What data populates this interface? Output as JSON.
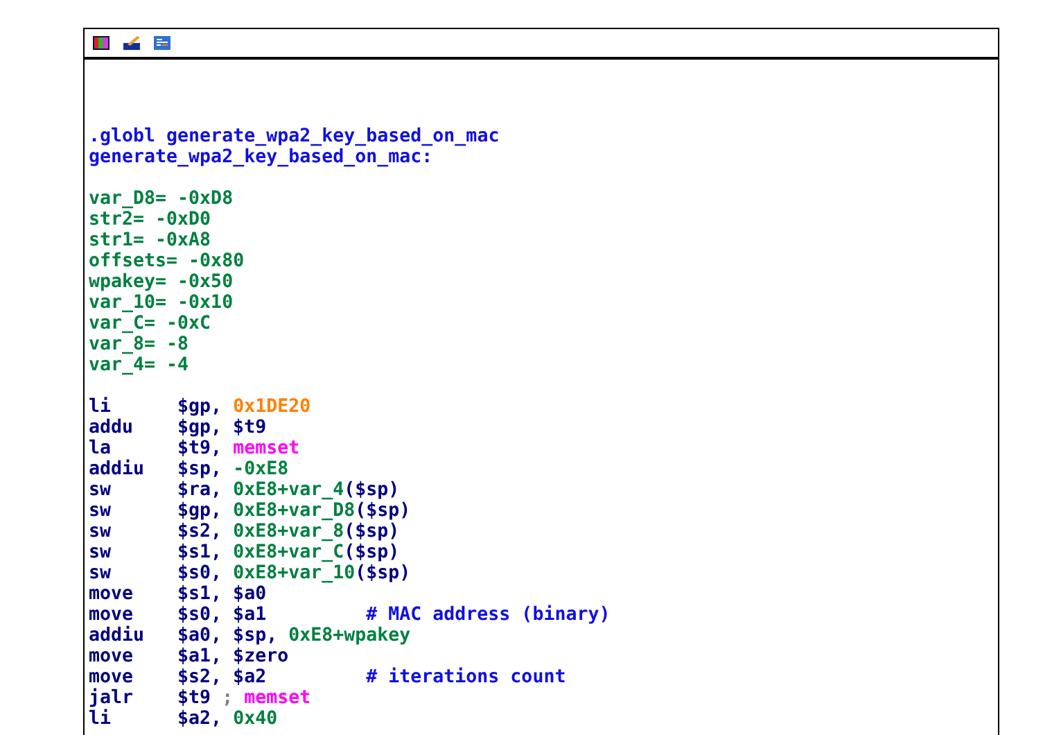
{
  "toolbar": {
    "buttons": [
      {
        "kind": "graph"
      },
      {
        "kind": "pencil"
      },
      {
        "kind": "text"
      }
    ]
  },
  "listing": [
    {
      "kind": "blank"
    },
    {
      "kind": "directive",
      "text": ".globl generate_wpa2_key_based_on_mac"
    },
    {
      "kind": "label",
      "text": "generate_wpa2_key_based_on_mac:"
    },
    {
      "kind": "blank"
    },
    {
      "kind": "var",
      "text": "var_D8= -0xD8"
    },
    {
      "kind": "var",
      "text": "str2= -0xD0"
    },
    {
      "kind": "var",
      "text": "str1= -0xA8"
    },
    {
      "kind": "var",
      "text": "offsets= -0x80"
    },
    {
      "kind": "var",
      "text": "wpakey= -0x50"
    },
    {
      "kind": "var",
      "text": "var_10= -0x10"
    },
    {
      "kind": "var",
      "text": "var_C= -0xC"
    },
    {
      "kind": "var",
      "text": "var_8= -8"
    },
    {
      "kind": "var",
      "text": "var_4= -4"
    },
    {
      "kind": "blank"
    },
    {
      "kind": "instr",
      "mnemonic": "li",
      "operands": [
        {
          "text": "$gp, ",
          "kind": "register"
        },
        {
          "text": "0x1DE20",
          "kind": "constant"
        }
      ]
    },
    {
      "kind": "instr",
      "mnemonic": "addu",
      "operands": [
        {
          "text": "$gp, $t9",
          "kind": "register"
        }
      ]
    },
    {
      "kind": "instr",
      "mnemonic": "la",
      "operands": [
        {
          "text": "$t9, ",
          "kind": "register"
        },
        {
          "text": "memset",
          "kind": "function"
        }
      ]
    },
    {
      "kind": "instr",
      "mnemonic": "addiu",
      "operands": [
        {
          "text": "$sp, ",
          "kind": "register"
        },
        {
          "text": "-0xE8",
          "kind": "number"
        }
      ]
    },
    {
      "kind": "instr",
      "mnemonic": "sw",
      "operands": [
        {
          "text": "$ra, ",
          "kind": "register"
        },
        {
          "text": "0xE8+var_4",
          "kind": "number"
        },
        {
          "text": "($sp)",
          "kind": "register"
        }
      ]
    },
    {
      "kind": "instr",
      "mnemonic": "sw",
      "operands": [
        {
          "text": "$gp, ",
          "kind": "register"
        },
        {
          "text": "0xE8+var_D8",
          "kind": "number"
        },
        {
          "text": "($sp)",
          "kind": "register"
        }
      ]
    },
    {
      "kind": "instr",
      "mnemonic": "sw",
      "operands": [
        {
          "text": "$s2, ",
          "kind": "register"
        },
        {
          "text": "0xE8+var_8",
          "kind": "number"
        },
        {
          "text": "($sp)",
          "kind": "register"
        }
      ]
    },
    {
      "kind": "instr",
      "mnemonic": "sw",
      "operands": [
        {
          "text": "$s1, ",
          "kind": "register"
        },
        {
          "text": "0xE8+var_C",
          "kind": "number"
        },
        {
          "text": "($sp)",
          "kind": "register"
        }
      ]
    },
    {
      "kind": "instr",
      "mnemonic": "sw",
      "operands": [
        {
          "text": "$s0, ",
          "kind": "register"
        },
        {
          "text": "0xE8+var_10",
          "kind": "number"
        },
        {
          "text": "($sp)",
          "kind": "register"
        }
      ]
    },
    {
      "kind": "instr",
      "mnemonic": "move",
      "operands": [
        {
          "text": "$s1, $a0",
          "kind": "register"
        }
      ]
    },
    {
      "kind": "instr",
      "mnemonic": "move",
      "operands": [
        {
          "text": "$s0, $a1",
          "kind": "register"
        }
      ],
      "comment": "# MAC address (binary)"
    },
    {
      "kind": "instr",
      "mnemonic": "addiu",
      "operands": [
        {
          "text": "$a0, $sp, ",
          "kind": "register"
        },
        {
          "text": "0xE8+wpakey",
          "kind": "number"
        }
      ]
    },
    {
      "kind": "instr",
      "mnemonic": "move",
      "operands": [
        {
          "text": "$a1, $zero",
          "kind": "register"
        }
      ]
    },
    {
      "kind": "instr",
      "mnemonic": "move",
      "operands": [
        {
          "text": "$s2, $a2",
          "kind": "register"
        }
      ],
      "comment": "# iterations count"
    },
    {
      "kind": "instr",
      "mnemonic": "jalr",
      "operands": [
        {
          "text": "$t9 ",
          "kind": "register"
        },
        {
          "text": "; ",
          "kind": "separator"
        },
        {
          "text": "memset",
          "kind": "function"
        }
      ]
    },
    {
      "kind": "instr",
      "mnemonic": "li",
      "operands": [
        {
          "text": "$a2, ",
          "kind": "register"
        },
        {
          "text": "0x40",
          "kind": "number"
        }
      ]
    }
  ]
}
